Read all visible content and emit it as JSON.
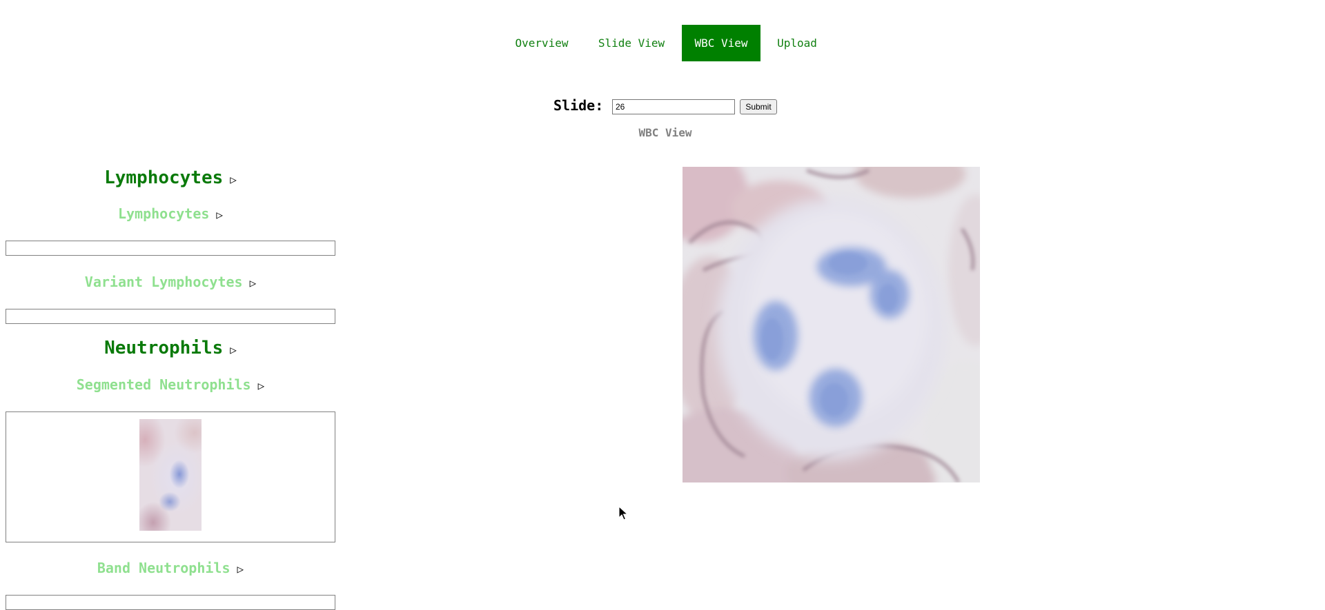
{
  "nav": {
    "items": [
      {
        "label": "Overview"
      },
      {
        "label": "Slide View"
      },
      {
        "label": "WBC View"
      },
      {
        "label": "Upload"
      }
    ],
    "active": "WBC View",
    "accent_color": "#008000"
  },
  "slide_form": {
    "label": "Slide:",
    "value": "26",
    "submit_label": "Submit"
  },
  "subtitle": "WBC View",
  "left_panel": {
    "groups": [
      {
        "heading": "Lymphocytes",
        "subgroups": [
          {
            "heading": "Lymphocytes"
          },
          {
            "heading": "Variant Lymphocytes"
          }
        ]
      },
      {
        "heading": "Neutrophils",
        "subgroups": [
          {
            "heading": "Segmented Neutrophils"
          },
          {
            "heading": "Band Neutrophils"
          }
        ]
      }
    ],
    "arrow_glyph": "▷"
  }
}
